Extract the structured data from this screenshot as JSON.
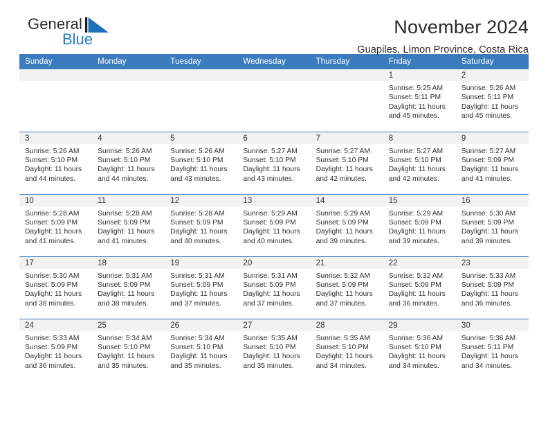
{
  "brand": {
    "name_part1": "General",
    "name_part2": "Blue",
    "accent_color": "#1f7bc1",
    "logo_icon": "triangle-flag-icon"
  },
  "header": {
    "title": "November 2024",
    "subtitle": "Guapiles, Limon Province, Costa Rica"
  },
  "calendar": {
    "header_bg": "#3a7cbe",
    "daynum_bg": "#f2f2f2",
    "weekday_headers": [
      "Sunday",
      "Monday",
      "Tuesday",
      "Wednesday",
      "Thursday",
      "Friday",
      "Saturday"
    ],
    "weeks": [
      [
        {
          "day": "",
          "empty": true
        },
        {
          "day": "",
          "empty": true
        },
        {
          "day": "",
          "empty": true
        },
        {
          "day": "",
          "empty": true
        },
        {
          "day": "",
          "empty": true
        },
        {
          "day": "1",
          "sunrise": "Sunrise: 5:25 AM",
          "sunset": "Sunset: 5:11 PM",
          "daylight": "Daylight: 11 hours and 45 minutes."
        },
        {
          "day": "2",
          "sunrise": "Sunrise: 5:26 AM",
          "sunset": "Sunset: 5:11 PM",
          "daylight": "Daylight: 11 hours and 45 minutes."
        }
      ],
      [
        {
          "day": "3",
          "sunrise": "Sunrise: 5:26 AM",
          "sunset": "Sunset: 5:10 PM",
          "daylight": "Daylight: 11 hours and 44 minutes."
        },
        {
          "day": "4",
          "sunrise": "Sunrise: 5:26 AM",
          "sunset": "Sunset: 5:10 PM",
          "daylight": "Daylight: 11 hours and 44 minutes."
        },
        {
          "day": "5",
          "sunrise": "Sunrise: 5:26 AM",
          "sunset": "Sunset: 5:10 PM",
          "daylight": "Daylight: 11 hours and 43 minutes."
        },
        {
          "day": "6",
          "sunrise": "Sunrise: 5:27 AM",
          "sunset": "Sunset: 5:10 PM",
          "daylight": "Daylight: 11 hours and 43 minutes."
        },
        {
          "day": "7",
          "sunrise": "Sunrise: 5:27 AM",
          "sunset": "Sunset: 5:10 PM",
          "daylight": "Daylight: 11 hours and 42 minutes."
        },
        {
          "day": "8",
          "sunrise": "Sunrise: 5:27 AM",
          "sunset": "Sunset: 5:10 PM",
          "daylight": "Daylight: 11 hours and 42 minutes."
        },
        {
          "day": "9",
          "sunrise": "Sunrise: 5:27 AM",
          "sunset": "Sunset: 5:09 PM",
          "daylight": "Daylight: 11 hours and 41 minutes."
        }
      ],
      [
        {
          "day": "10",
          "sunrise": "Sunrise: 5:28 AM",
          "sunset": "Sunset: 5:09 PM",
          "daylight": "Daylight: 11 hours and 41 minutes."
        },
        {
          "day": "11",
          "sunrise": "Sunrise: 5:28 AM",
          "sunset": "Sunset: 5:09 PM",
          "daylight": "Daylight: 11 hours and 41 minutes."
        },
        {
          "day": "12",
          "sunrise": "Sunrise: 5:28 AM",
          "sunset": "Sunset: 5:09 PM",
          "daylight": "Daylight: 11 hours and 40 minutes."
        },
        {
          "day": "13",
          "sunrise": "Sunrise: 5:29 AM",
          "sunset": "Sunset: 5:09 PM",
          "daylight": "Daylight: 11 hours and 40 minutes."
        },
        {
          "day": "14",
          "sunrise": "Sunrise: 5:29 AM",
          "sunset": "Sunset: 5:09 PM",
          "daylight": "Daylight: 11 hours and 39 minutes."
        },
        {
          "day": "15",
          "sunrise": "Sunrise: 5:29 AM",
          "sunset": "Sunset: 5:09 PM",
          "daylight": "Daylight: 11 hours and 39 minutes."
        },
        {
          "day": "16",
          "sunrise": "Sunrise: 5:30 AM",
          "sunset": "Sunset: 5:09 PM",
          "daylight": "Daylight: 11 hours and 39 minutes."
        }
      ],
      [
        {
          "day": "17",
          "sunrise": "Sunrise: 5:30 AM",
          "sunset": "Sunset: 5:09 PM",
          "daylight": "Daylight: 11 hours and 38 minutes."
        },
        {
          "day": "18",
          "sunrise": "Sunrise: 5:31 AM",
          "sunset": "Sunset: 5:09 PM",
          "daylight": "Daylight: 11 hours and 38 minutes."
        },
        {
          "day": "19",
          "sunrise": "Sunrise: 5:31 AM",
          "sunset": "Sunset: 5:09 PM",
          "daylight": "Daylight: 11 hours and 37 minutes."
        },
        {
          "day": "20",
          "sunrise": "Sunrise: 5:31 AM",
          "sunset": "Sunset: 5:09 PM",
          "daylight": "Daylight: 11 hours and 37 minutes."
        },
        {
          "day": "21",
          "sunrise": "Sunrise: 5:32 AM",
          "sunset": "Sunset: 5:09 PM",
          "daylight": "Daylight: 11 hours and 37 minutes."
        },
        {
          "day": "22",
          "sunrise": "Sunrise: 5:32 AM",
          "sunset": "Sunset: 5:09 PM",
          "daylight": "Daylight: 11 hours and 36 minutes."
        },
        {
          "day": "23",
          "sunrise": "Sunrise: 5:33 AM",
          "sunset": "Sunset: 5:09 PM",
          "daylight": "Daylight: 11 hours and 36 minutes."
        }
      ],
      [
        {
          "day": "24",
          "sunrise": "Sunrise: 5:33 AM",
          "sunset": "Sunset: 5:09 PM",
          "daylight": "Daylight: 11 hours and 36 minutes."
        },
        {
          "day": "25",
          "sunrise": "Sunrise: 5:34 AM",
          "sunset": "Sunset: 5:10 PM",
          "daylight": "Daylight: 11 hours and 35 minutes."
        },
        {
          "day": "26",
          "sunrise": "Sunrise: 5:34 AM",
          "sunset": "Sunset: 5:10 PM",
          "daylight": "Daylight: 11 hours and 35 minutes."
        },
        {
          "day": "27",
          "sunrise": "Sunrise: 5:35 AM",
          "sunset": "Sunset: 5:10 PM",
          "daylight": "Daylight: 11 hours and 35 minutes."
        },
        {
          "day": "28",
          "sunrise": "Sunrise: 5:35 AM",
          "sunset": "Sunset: 5:10 PM",
          "daylight": "Daylight: 11 hours and 34 minutes."
        },
        {
          "day": "29",
          "sunrise": "Sunrise: 5:36 AM",
          "sunset": "Sunset: 5:10 PM",
          "daylight": "Daylight: 11 hours and 34 minutes."
        },
        {
          "day": "30",
          "sunrise": "Sunrise: 5:36 AM",
          "sunset": "Sunset: 5:11 PM",
          "daylight": "Daylight: 11 hours and 34 minutes."
        }
      ]
    ]
  }
}
